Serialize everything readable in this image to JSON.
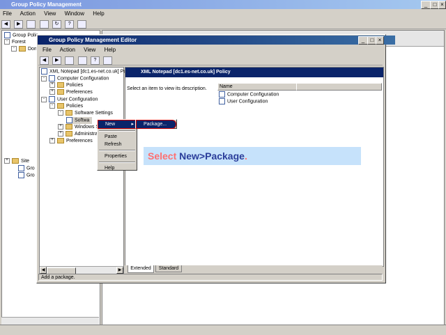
{
  "outer": {
    "title": "Group Policy Management",
    "menu": [
      "File",
      "Action",
      "View",
      "Window",
      "Help"
    ],
    "tree": [
      "Group Polic",
      "Forest",
      "Dom",
      "Site",
      "Gro",
      "Gro"
    ]
  },
  "editor": {
    "title": "Group Policy Management Editor",
    "menu": [
      "File",
      "Action",
      "View",
      "Help"
    ],
    "tree": {
      "root": "XML Notepad [dc1.es-net.co.uk] Po",
      "computer_config": "Computer Configuration",
      "policies_1": "Policies",
      "preferences_1": "Preferences",
      "user_config": "User Configuration",
      "policies_2": "Policies",
      "software_settings": "Software Settings",
      "software_install": "Softwa",
      "windows_settings": "Windows Se",
      "admin_templates": "Administra",
      "preferences_2": "Preferences"
    },
    "right": {
      "header": "XML Notepad [dc1.es-net.co.uk] Policy",
      "hint": "Select an item to view its description.",
      "col_name": "Name",
      "items": [
        "Computer Configuration",
        "User Configuration"
      ]
    },
    "tabs": [
      "Extended",
      "Standard"
    ],
    "status": "Add a package."
  },
  "context_menu": {
    "new": "New",
    "paste": "Paste",
    "refresh": "Refresh",
    "properties": "Properties",
    "help": "Help",
    "submenu_package": "Package..."
  },
  "annotation": {
    "select": "Select",
    "rest": "New>Package",
    "period": "."
  },
  "colors": {
    "annotation_bg": "#c6e2fb",
    "annotation_select": "#ff7070",
    "annotation_rest": "#2a3d9a",
    "header_bar": "#0a246a",
    "highlight": "#cc0000"
  }
}
